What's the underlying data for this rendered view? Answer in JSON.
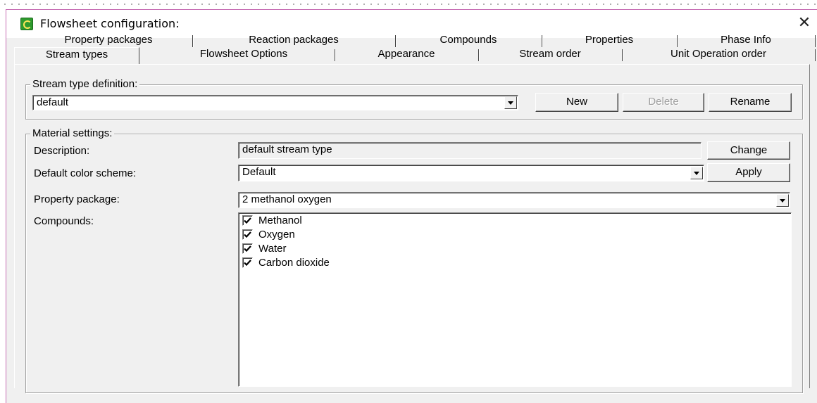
{
  "window": {
    "title": "Flowsheet configuration:",
    "icon": "app-icon",
    "close_glyph": "✕"
  },
  "tabs": {
    "row1": [
      "Property packages",
      "Reaction packages",
      "Compounds",
      "Properties",
      "Phase Info"
    ],
    "row2": [
      "Stream types",
      "Flowsheet Options",
      "Appearance",
      "Stream order",
      "Unit Operation order"
    ],
    "active": "Stream types"
  },
  "stream_type": {
    "legend": "Stream type definition:",
    "selected": "default",
    "new_label": "New",
    "delete_label": "Delete",
    "rename_label": "Rename"
  },
  "material": {
    "legend": "Material settings:",
    "description_label": "Description:",
    "description_value": "default stream type",
    "change_label": "Change",
    "color_label": "Default color scheme:",
    "color_value": "Default",
    "apply_label": "Apply",
    "package_label": "Property package:",
    "package_value": "2 methanol oxygen",
    "compounds_label": "Compounds:",
    "compounds": [
      {
        "name": "Methanol",
        "checked": true
      },
      {
        "name": "Oxygen",
        "checked": true
      },
      {
        "name": "Water",
        "checked": true
      },
      {
        "name": "Carbon dioxide",
        "checked": true
      }
    ]
  }
}
